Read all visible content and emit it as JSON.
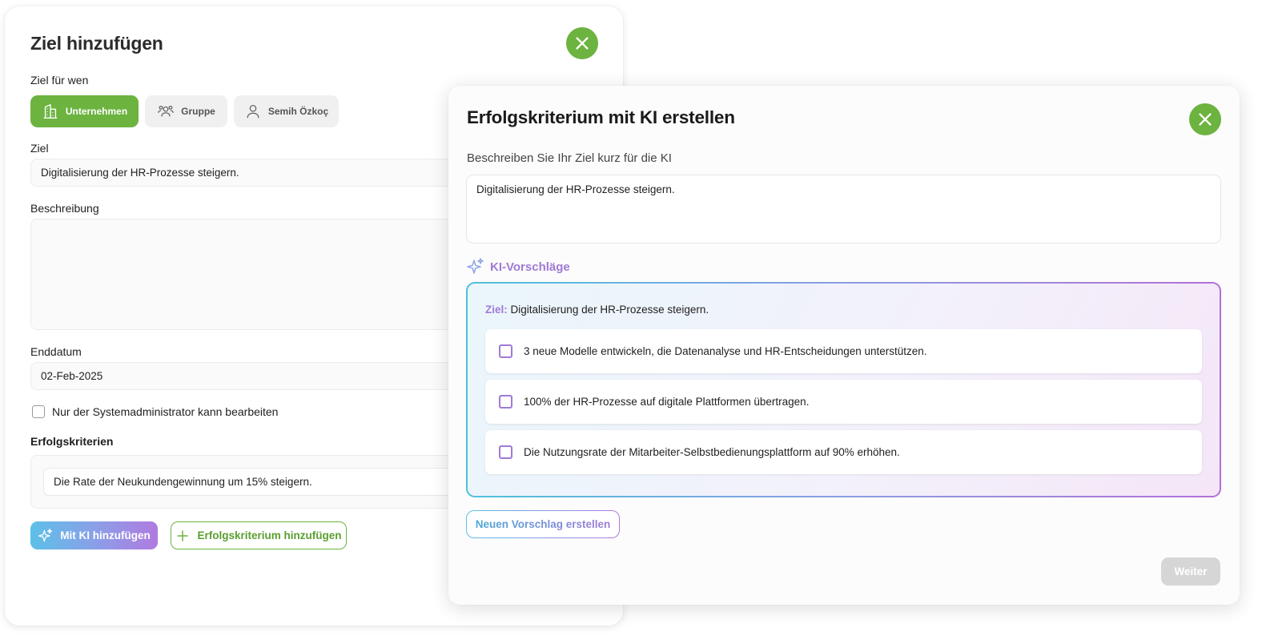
{
  "add_goal": {
    "title": "Ziel hinzufügen",
    "target_label": "Ziel für wen",
    "targets": [
      {
        "label": "Unternehmen",
        "icon": "building-icon"
      },
      {
        "label": "Gruppe",
        "icon": "group-icon"
      },
      {
        "label": "Semih Özkoç",
        "icon": "user-icon"
      }
    ],
    "goal_label": "Ziel",
    "goal_value": "Digitalisierung der HR-Prozesse steigern.",
    "description_label": "Beschreibung",
    "description_value": "",
    "end_date_label": "Enddatum",
    "end_date_value": "02-Feb-2025",
    "admin_only_label": "Nur der Systemadministrator kann bearbeiten",
    "admin_only_checked": false,
    "criteria_label": "Erfolgskriterien",
    "criteria": [
      "Die Rate der Neukundengewinnung um 15% steigern."
    ],
    "ai_button_label": "Mit KI hinzufügen",
    "add_criterion_label": "Erfolgskriterium hinzufügen"
  },
  "ai_dialog": {
    "title": "Erfolgskriterium mit KI erstellen",
    "prompt_label": "Beschreiben Sie Ihr Ziel kurz für die KI",
    "prompt_value": "Digitalisierung der HR-Prozesse steigern.",
    "suggestions_title": "KI-Vorschläge",
    "goal_prefix": "Ziel:",
    "goal_text": "Digitalisierung der HR-Prozesse steigern.",
    "suggestions": [
      "3 neue Modelle entwickeln, die Datenanalyse und HR-Entscheidungen unterstützen.",
      "100% der HR-Prozesse auf digitale Plattformen übertragen.",
      "Die Nutzungsrate der Mitarbeiter-Selbstbedienungsplattform auf 90% erhöhen."
    ],
    "new_suggestion_label": "Neuen Vorschlag erstellen",
    "next_label": "Weiter"
  },
  "colors": {
    "accent_green": "#6cb33f",
    "ai_purple": "#a07ad6",
    "ai_blue": "#5cc0e8",
    "disabled": "#d6d6d6"
  }
}
